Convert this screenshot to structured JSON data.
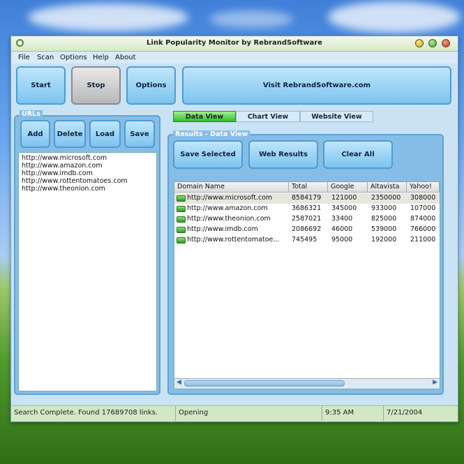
{
  "window": {
    "title": "Link Popularity Monitor by RebrandSoftware"
  },
  "menu": [
    "File",
    "Scan",
    "Options",
    "Help",
    "About"
  ],
  "toolbar": {
    "start": "Start",
    "stop": "Stop",
    "options": "Options",
    "visit": "Visit RebrandSoftware.com"
  },
  "urls": {
    "label": "URLs",
    "add": "Add",
    "delete": "Delete",
    "load": "Load",
    "save": "Save",
    "items": [
      "http://www.microsoft.com",
      "http://www.amazon.com",
      "http://www.imdb.com",
      "http://www.rottentomatoes.com",
      "http://www.theonion.com"
    ]
  },
  "tabs": [
    "Data View",
    "Chart View",
    "Website View"
  ],
  "results": {
    "label": "Results - Data View",
    "save_selected": "Save Selected",
    "web_results": "Web Results",
    "clear_all": "Clear All",
    "columns": [
      "Domain Name",
      "Total",
      "Google",
      "Altavista",
      "Yahoo!"
    ],
    "rows": [
      [
        "http://www.microsoft.com",
        "8584179",
        "121000",
        "2350000",
        "308000"
      ],
      [
        "http://www.amazon.com",
        "3686321",
        "345000",
        "933000",
        "107000"
      ],
      [
        "http://www.theonion.com",
        "2587021",
        "33400",
        "825000",
        "874000"
      ],
      [
        "http://www.imdb.com",
        "2086692",
        "46000",
        "539000",
        "766000"
      ],
      [
        "http://www.rottentomatoe...",
        "745495",
        "95000",
        "192000",
        "211000"
      ]
    ]
  },
  "status": {
    "message": "Search Complete.  Found 17689708 links.",
    "state": "Opening",
    "time": "9:35 AM",
    "date": "7/21/2004"
  },
  "colors": {
    "accent": "#7cc3ef",
    "tab_active": "#33c633",
    "row_icon": "#2f9a22"
  }
}
